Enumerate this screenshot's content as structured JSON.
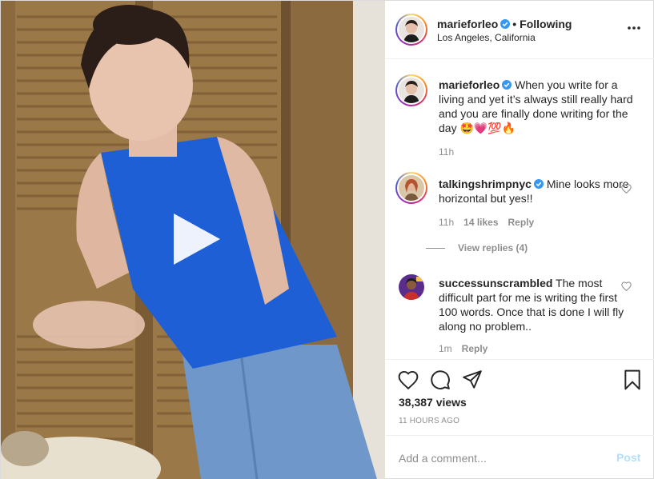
{
  "post": {
    "author": "marieforleo",
    "author_verified": true,
    "separator": "•",
    "follow_state": "Following",
    "location": "Los Angeles, California"
  },
  "media": {
    "type": "video",
    "play_icon": "play-icon"
  },
  "comments": [
    {
      "username": "marieforleo",
      "verified": true,
      "text": "When you write for a living and yet it’s always still really hard and you are finally done writing for the day 🤩💗💯🔥",
      "time": "11h",
      "is_caption": true
    },
    {
      "username": "talkingshrimpnyc",
      "verified": true,
      "text": "Mine looks more horizontal but yes!!",
      "time": "11h",
      "likes": "14 likes",
      "reply_label": "Reply",
      "view_replies": "View replies (4)"
    },
    {
      "username": "successunscrambled",
      "verified": false,
      "text": "The most difficult part for me is writing the first 100 words. Once that is done I will fly along no problem..",
      "time": "1m",
      "reply_label": "Reply"
    }
  ],
  "actions": {
    "like_icon": "heart-icon",
    "comment_icon": "comment-icon",
    "share_icon": "share-icon",
    "save_icon": "bookmark-icon",
    "views": "38,387 views",
    "timestamp": "11 HOURS AGO"
  },
  "add_comment": {
    "placeholder": "Add a comment...",
    "post_label": "Post",
    "post_color": "#b2dffc"
  },
  "colors": {
    "verified_badge": "#3897f0",
    "text": "#262626",
    "muted": "#8e8e8e",
    "shirt_blue": "#1f5fd6"
  }
}
